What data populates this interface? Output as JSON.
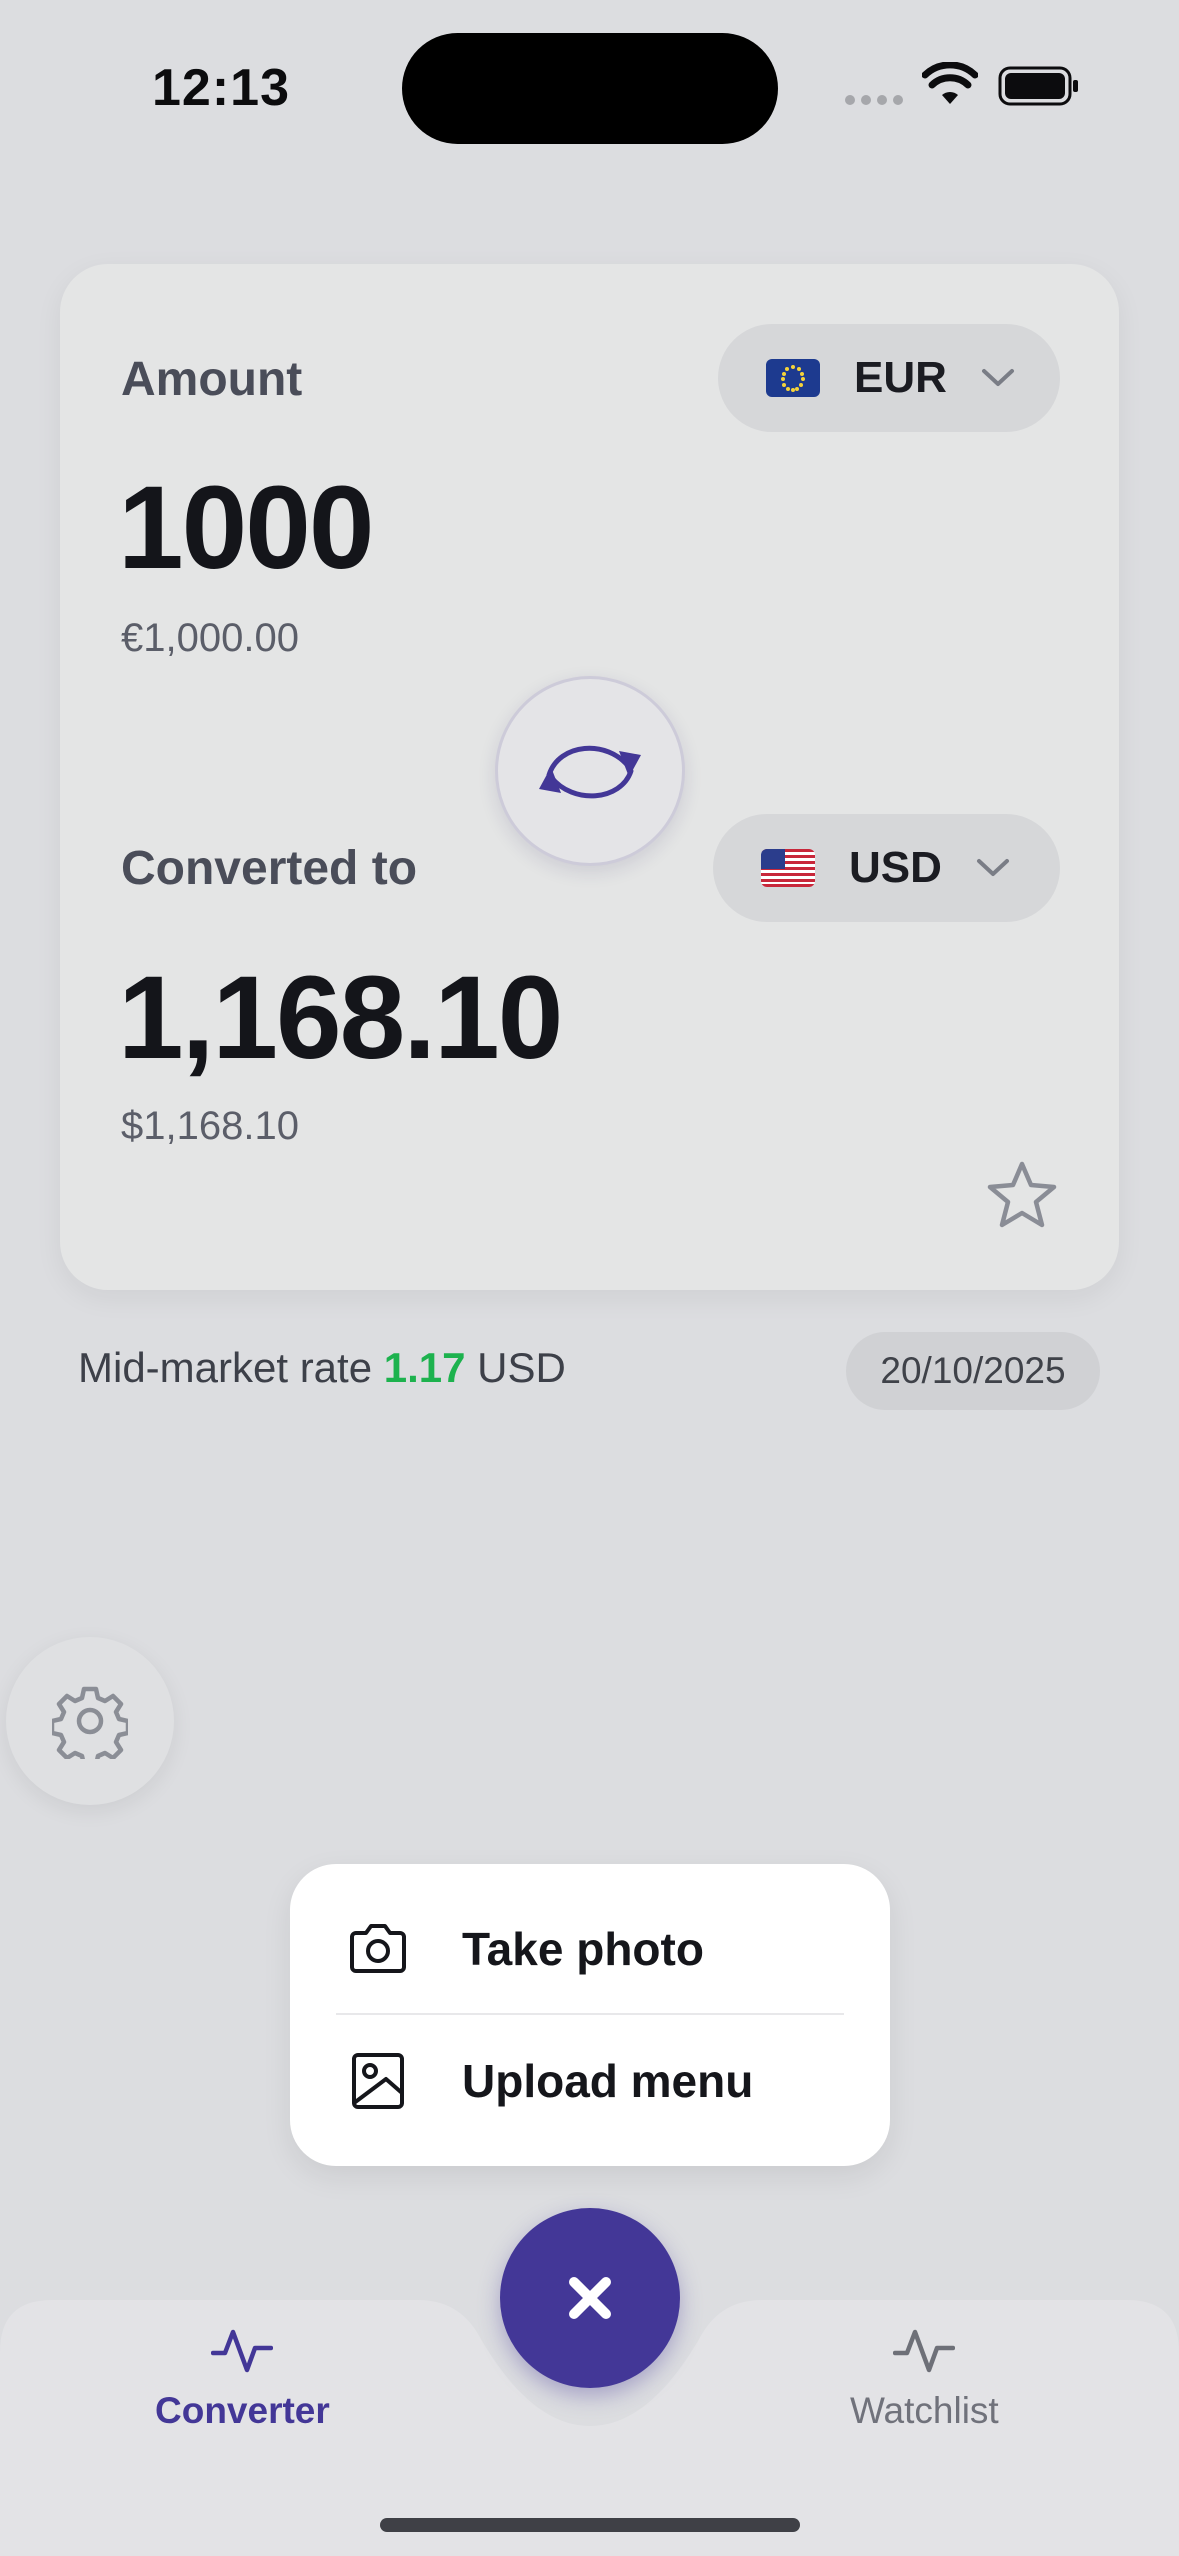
{
  "status_bar": {
    "time": "12:13"
  },
  "converter": {
    "amount_label": "Amount",
    "from_currency": {
      "code": "EUR",
      "flag": "eu-flag-icon"
    },
    "amount_value": "1000",
    "amount_formatted": "€1,000.00",
    "converted_label": "Converted to",
    "to_currency": {
      "code": "USD",
      "flag": "us-flag-icon"
    },
    "converted_value": "1,168.10",
    "converted_formatted": "$1,168.10"
  },
  "rate": {
    "prefix": "Mid-market rate",
    "value": "1.17",
    "unit": "USD",
    "date": "20/10/2025"
  },
  "popup_menu": {
    "items": [
      {
        "label": "Take photo",
        "icon": "camera-icon"
      },
      {
        "label": "Upload menu",
        "icon": "image-icon"
      }
    ]
  },
  "tab_bar": {
    "tabs": [
      {
        "label": "Converter",
        "icon": "activity-icon",
        "active": true
      },
      {
        "label": "Watchlist",
        "icon": "activity-icon",
        "active": false
      }
    ]
  },
  "colors": {
    "accent": "#433797",
    "rate_value": "#1db24e",
    "background": "#dcdde0",
    "card": "#e4e5e5"
  }
}
